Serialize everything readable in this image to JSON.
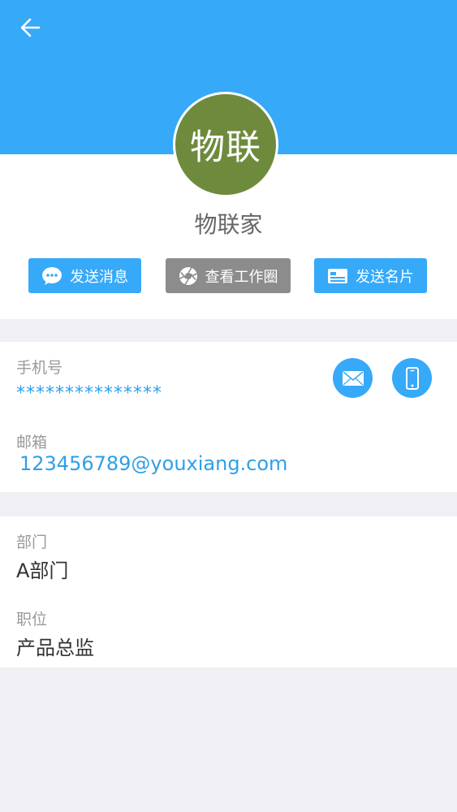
{
  "header": {
    "back_icon": "arrow-left-icon",
    "color": "#36a9f9"
  },
  "profile": {
    "avatar_text": "物联",
    "avatar_color": "#6e8b3d",
    "name": "物联家"
  },
  "actions": [
    {
      "label": "发送消息",
      "icon": "chat-bubble-icon",
      "color": "#36a9f9"
    },
    {
      "label": "查看工作圈",
      "icon": "aperture-icon",
      "color": "#8c8c8c"
    },
    {
      "label": "发送名片",
      "icon": "card-icon",
      "color": "#36a9f9"
    }
  ],
  "contact": {
    "phone_label": "手机号",
    "phone_value": "***************",
    "email_label": "邮箱",
    "email_value": "123456789@youxiang.com"
  },
  "work": {
    "department_label": "部门",
    "department_value": "A部门",
    "position_label": "职位",
    "position_value": "产品总监"
  }
}
